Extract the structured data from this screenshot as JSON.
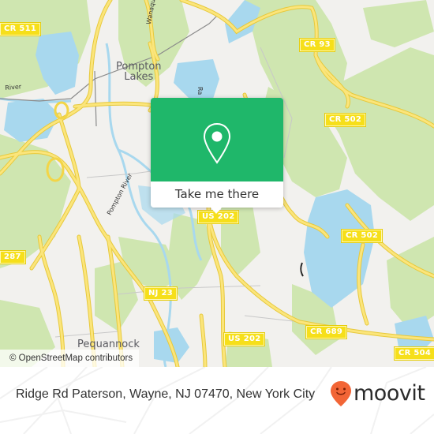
{
  "map": {
    "popup": {
      "icon": "map-pin-icon",
      "button_label": "Take me there",
      "color": "#1fb76a"
    },
    "place_labels": [
      {
        "id": "pompton-lakes",
        "lines": [
          "Pompton",
          "Lakes"
        ]
      },
      {
        "id": "pequannock",
        "lines": [
          "Pequannock"
        ]
      }
    ],
    "road_labels": {
      "wanaque": "Wanaque",
      "ramapo": "Ra",
      "pompton_river": "Pompton River",
      "river_left": "River"
    },
    "shields": {
      "cr511": "CR 511",
      "cr93": "CR 93",
      "cr502_top": "CR 502",
      "cr502_mid": "CR 502",
      "us202_top": "US 202",
      "us202_bottom": "US 202",
      "i287": "287",
      "nj23": "NJ 23",
      "cr689": "CR 689",
      "cr504": "CR 504"
    },
    "attribution": "© OpenStreetMap contributors",
    "colors": {
      "land": "#f2f1ee",
      "park": "#cfe6b0",
      "water": "#a8d8ee",
      "road": "#f9dc5c",
      "shield": "#f6df1a"
    }
  },
  "footer": {
    "address": "Ridge Rd Paterson, Wayne, NJ 07470, New York City",
    "brand": "moovit",
    "brand_icon": "moovit-smiley-pin-icon",
    "brand_color": "#f26536"
  }
}
